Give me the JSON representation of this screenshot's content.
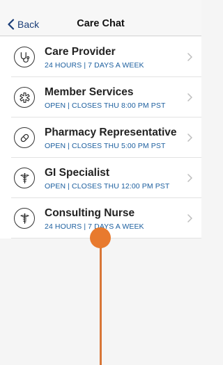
{
  "header": {
    "back_label": "Back",
    "title": "Care Chat"
  },
  "list": [
    {
      "icon": "stethoscope-icon",
      "title": "Care Provider",
      "subtitle": "24 HOURS | 7 DAYS A WEEK"
    },
    {
      "icon": "star-of-life-icon",
      "title": "Member Services",
      "subtitle": "OPEN | CLOSES THU 8:00 PM PST"
    },
    {
      "icon": "pill-icon",
      "title": "Pharmacy Representative",
      "subtitle": "OPEN | CLOSES THU 5:00 PM PST"
    },
    {
      "icon": "caduceus-icon",
      "title": "GI Specialist",
      "subtitle": "OPEN | CLOSES THU 12:00 PM PST"
    },
    {
      "icon": "caduceus-icon",
      "title": "Consulting Nurse",
      "subtitle": "24 HOURS | 7 DAYS A WEEK"
    }
  ],
  "colors": {
    "accent": "#1b5e9e",
    "back": "#1a3d78",
    "pointer": "#e87a2e"
  }
}
